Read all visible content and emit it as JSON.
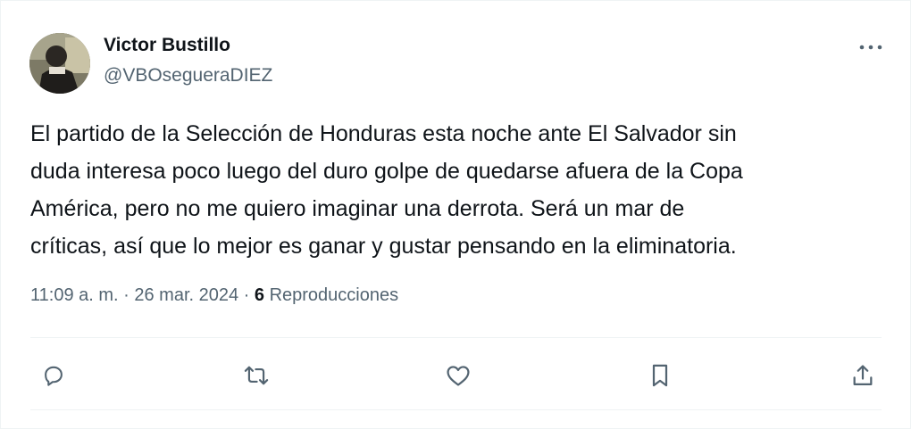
{
  "author": {
    "name": "Victor Bustillo",
    "handle": "@VBOsegueraDIEZ"
  },
  "tweet": {
    "text": "El partido de la Selección de Honduras esta noche ante El Salvador sin\nduda interesa poco luego del duro golpe de quedarse afuera de la Copa\nAmérica, pero no me quiero imaginar una derrota. Será un mar de\ncríticas, así que lo mejor es ganar y gustar pensando en la eliminatoria."
  },
  "meta": {
    "time": "11:09 a. m.",
    "separator": " · ",
    "date": "26 mar. 2024",
    "views_count": "6",
    "views_label": " Reproducciones"
  },
  "icons": {
    "more": "more-dots-icon",
    "reply": "reply-icon",
    "retweet": "retweet-icon",
    "like": "heart-icon",
    "bookmark": "bookmark-icon",
    "share": "share-icon"
  },
  "colors": {
    "text_primary": "#0f1419",
    "text_secondary": "#536471",
    "divider": "#eff3f4"
  }
}
